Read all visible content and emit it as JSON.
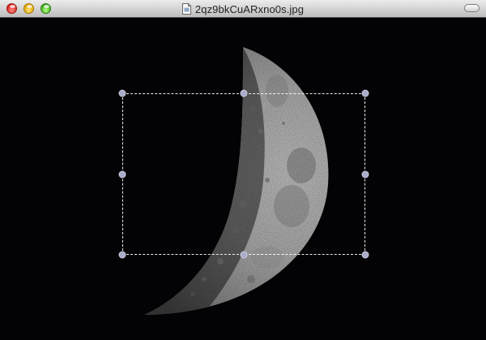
{
  "window": {
    "title": "2qz9bkCuARxno0s.jpg",
    "controls": [
      "close-button",
      "minimize-button",
      "zoom-button"
    ],
    "file_icon": "document-icon",
    "toolbar_toggle_icon": "toolbar-pill-icon"
  },
  "viewer": {
    "background_color": "#030305",
    "image_subject": "moon-photo",
    "selection": {
      "style": "dashed",
      "handles": [
        "top-left",
        "top-center",
        "top-right",
        "middle-left",
        "middle-right",
        "bottom-left",
        "bottom-center",
        "bottom-right"
      ]
    }
  }
}
